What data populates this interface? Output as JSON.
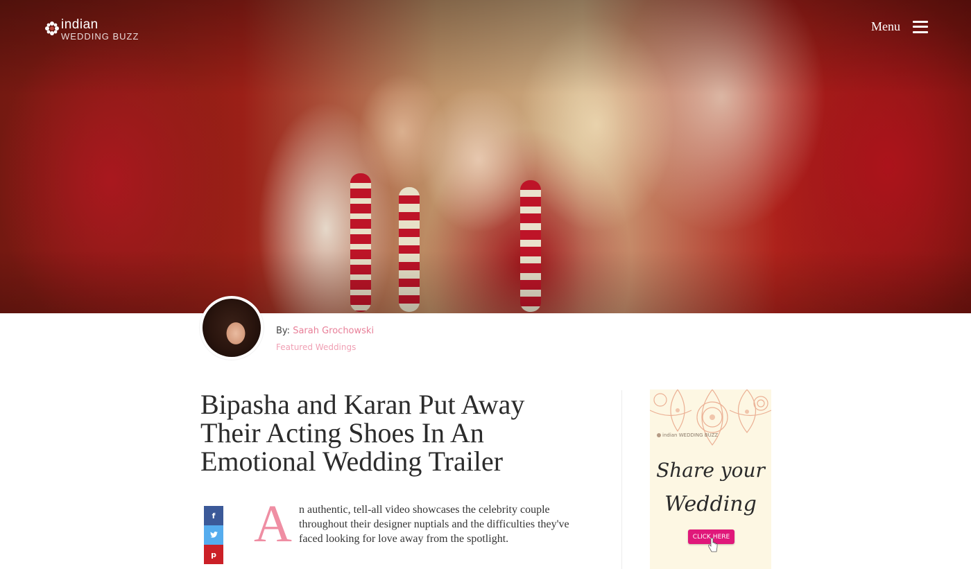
{
  "header": {
    "logo": {
      "line1": "indian",
      "line2": "WEDDING BUZZ"
    },
    "menu_label": "Menu"
  },
  "hero": {
    "image": "Bride and groom touching foreheads during wedding ceremony, guests in red saris behind"
  },
  "author": {
    "prefix": "By: ",
    "name": "Sarah Grochowski",
    "category": "Featured Weddings"
  },
  "article": {
    "title": "Bipasha and Karan Put Away Their Acting Shoes In An Emotional Wedding Trailer",
    "dropcap": "A",
    "lead": "n authentic, tell-all video showcases the celebrity couple throughout their designer nuptials and the difficulties they've faced looking for love away from the spotlight."
  },
  "share": {
    "facebook_icon": "f",
    "twitter_icon": "t",
    "pinterest_icon": "p"
  },
  "ad": {
    "logo_line1": "indian",
    "logo_line2": "WEDDING BUZZ",
    "line1": "Share your",
    "line2": "Wedding",
    "cta": "CLICK HERE"
  },
  "colors": {
    "accent_pink": "#e87f98",
    "dropcap": "#ef8ea3",
    "facebook": "#3b5998",
    "twitter": "#55acee",
    "pinterest": "#cb2027",
    "ad_cta": "#e0187a"
  }
}
